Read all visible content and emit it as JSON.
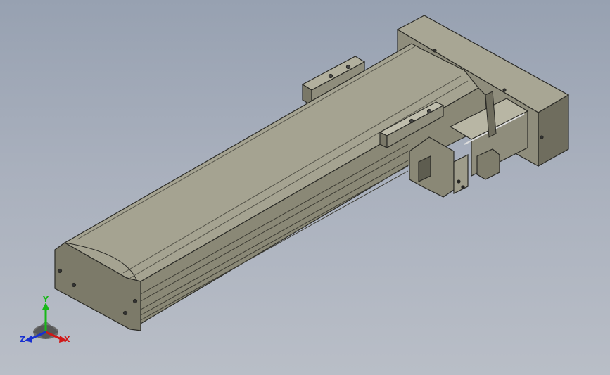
{
  "viewport": {
    "background_top": "#97a1b1",
    "background_bottom": "#b9bec7",
    "part_color": "#8e8c7a",
    "edge_color": "#2a2a26"
  },
  "triad": {
    "x_label": "X",
    "y_label": "Y",
    "z_label": "Z",
    "x_color": "#d01818",
    "y_color": "#18b818",
    "z_color": "#1830d0"
  }
}
